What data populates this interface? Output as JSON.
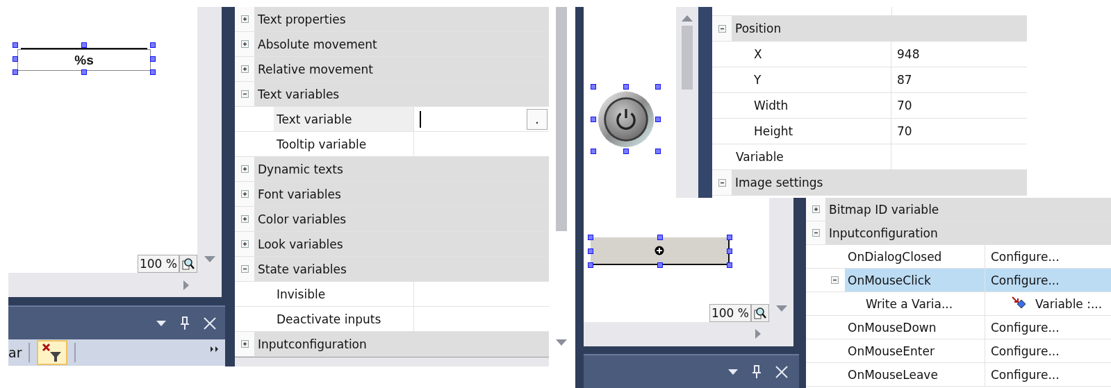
{
  "left_editor": {
    "element_text": "%s",
    "zoom": "100 %",
    "toolbar_text": "ar"
  },
  "property_grid_1": {
    "rows": [
      {
        "kind": "group",
        "label": "Text properties",
        "expanded": false
      },
      {
        "kind": "group",
        "label": "Absolute movement",
        "expanded": false
      },
      {
        "kind": "group",
        "label": "Relative movement",
        "expanded": false
      },
      {
        "kind": "group",
        "label": "Text variables",
        "expanded": true,
        "children": [
          {
            "kind": "property",
            "label": "Text variable",
            "selected": true,
            "editor_button": "."
          },
          {
            "kind": "property",
            "label": "Tooltip variable",
            "selected": false
          }
        ]
      },
      {
        "kind": "group",
        "label": "Dynamic texts",
        "expanded": false
      },
      {
        "kind": "group",
        "label": "Font variables",
        "expanded": false
      },
      {
        "kind": "group",
        "label": "Color variables",
        "expanded": false
      },
      {
        "kind": "group",
        "label": "Look variables",
        "expanded": false
      },
      {
        "kind": "group",
        "label": "State variables",
        "expanded": true,
        "children": [
          {
            "kind": "property",
            "label": "Invisible",
            "selected": false
          },
          {
            "kind": "property",
            "label": "Deactivate inputs",
            "selected": false
          }
        ]
      },
      {
        "kind": "group",
        "label": "Inputconfiguration",
        "expanded": false
      }
    ]
  },
  "middle_editor": {
    "zoom": "100 %"
  },
  "property_grid_2": {
    "rows": [
      {
        "kind": "group",
        "label": "Position",
        "expanded": true,
        "children": [
          {
            "kind": "property",
            "label": "X",
            "value": "948"
          },
          {
            "kind": "property",
            "label": "Y",
            "value": "87"
          },
          {
            "kind": "property",
            "label": "Width",
            "value": "70"
          },
          {
            "kind": "property",
            "label": "Height",
            "value": "70"
          }
        ]
      },
      {
        "kind": "property",
        "label": "Variable"
      },
      {
        "kind": "group",
        "label": "Image settings",
        "expanded": true
      }
    ]
  },
  "property_grid_3": {
    "rows": [
      {
        "kind": "group",
        "label": "Bitmap ID variable",
        "expanded": false
      },
      {
        "kind": "group",
        "label": "Inputconfiguration",
        "expanded": true,
        "children": [
          {
            "kind": "property",
            "label": "OnDialogClosed",
            "value": "Configure...",
            "selected": false
          },
          {
            "kind": "property",
            "label": "OnMouseClick",
            "value": "Configure...",
            "selected": true,
            "expanded": true,
            "children": [
              {
                "kind": "action",
                "label": "Write a Varia...",
                "value": "Variable :...",
                "selected": false
              }
            ]
          },
          {
            "kind": "property",
            "label": "OnMouseDown",
            "value": "Configure...",
            "selected": false
          },
          {
            "kind": "property",
            "label": "OnMouseEnter",
            "value": "Configure...",
            "selected": false
          },
          {
            "kind": "property",
            "label": "OnMouseLeave",
            "value": "Configure...",
            "selected": false
          }
        ]
      }
    ]
  }
}
